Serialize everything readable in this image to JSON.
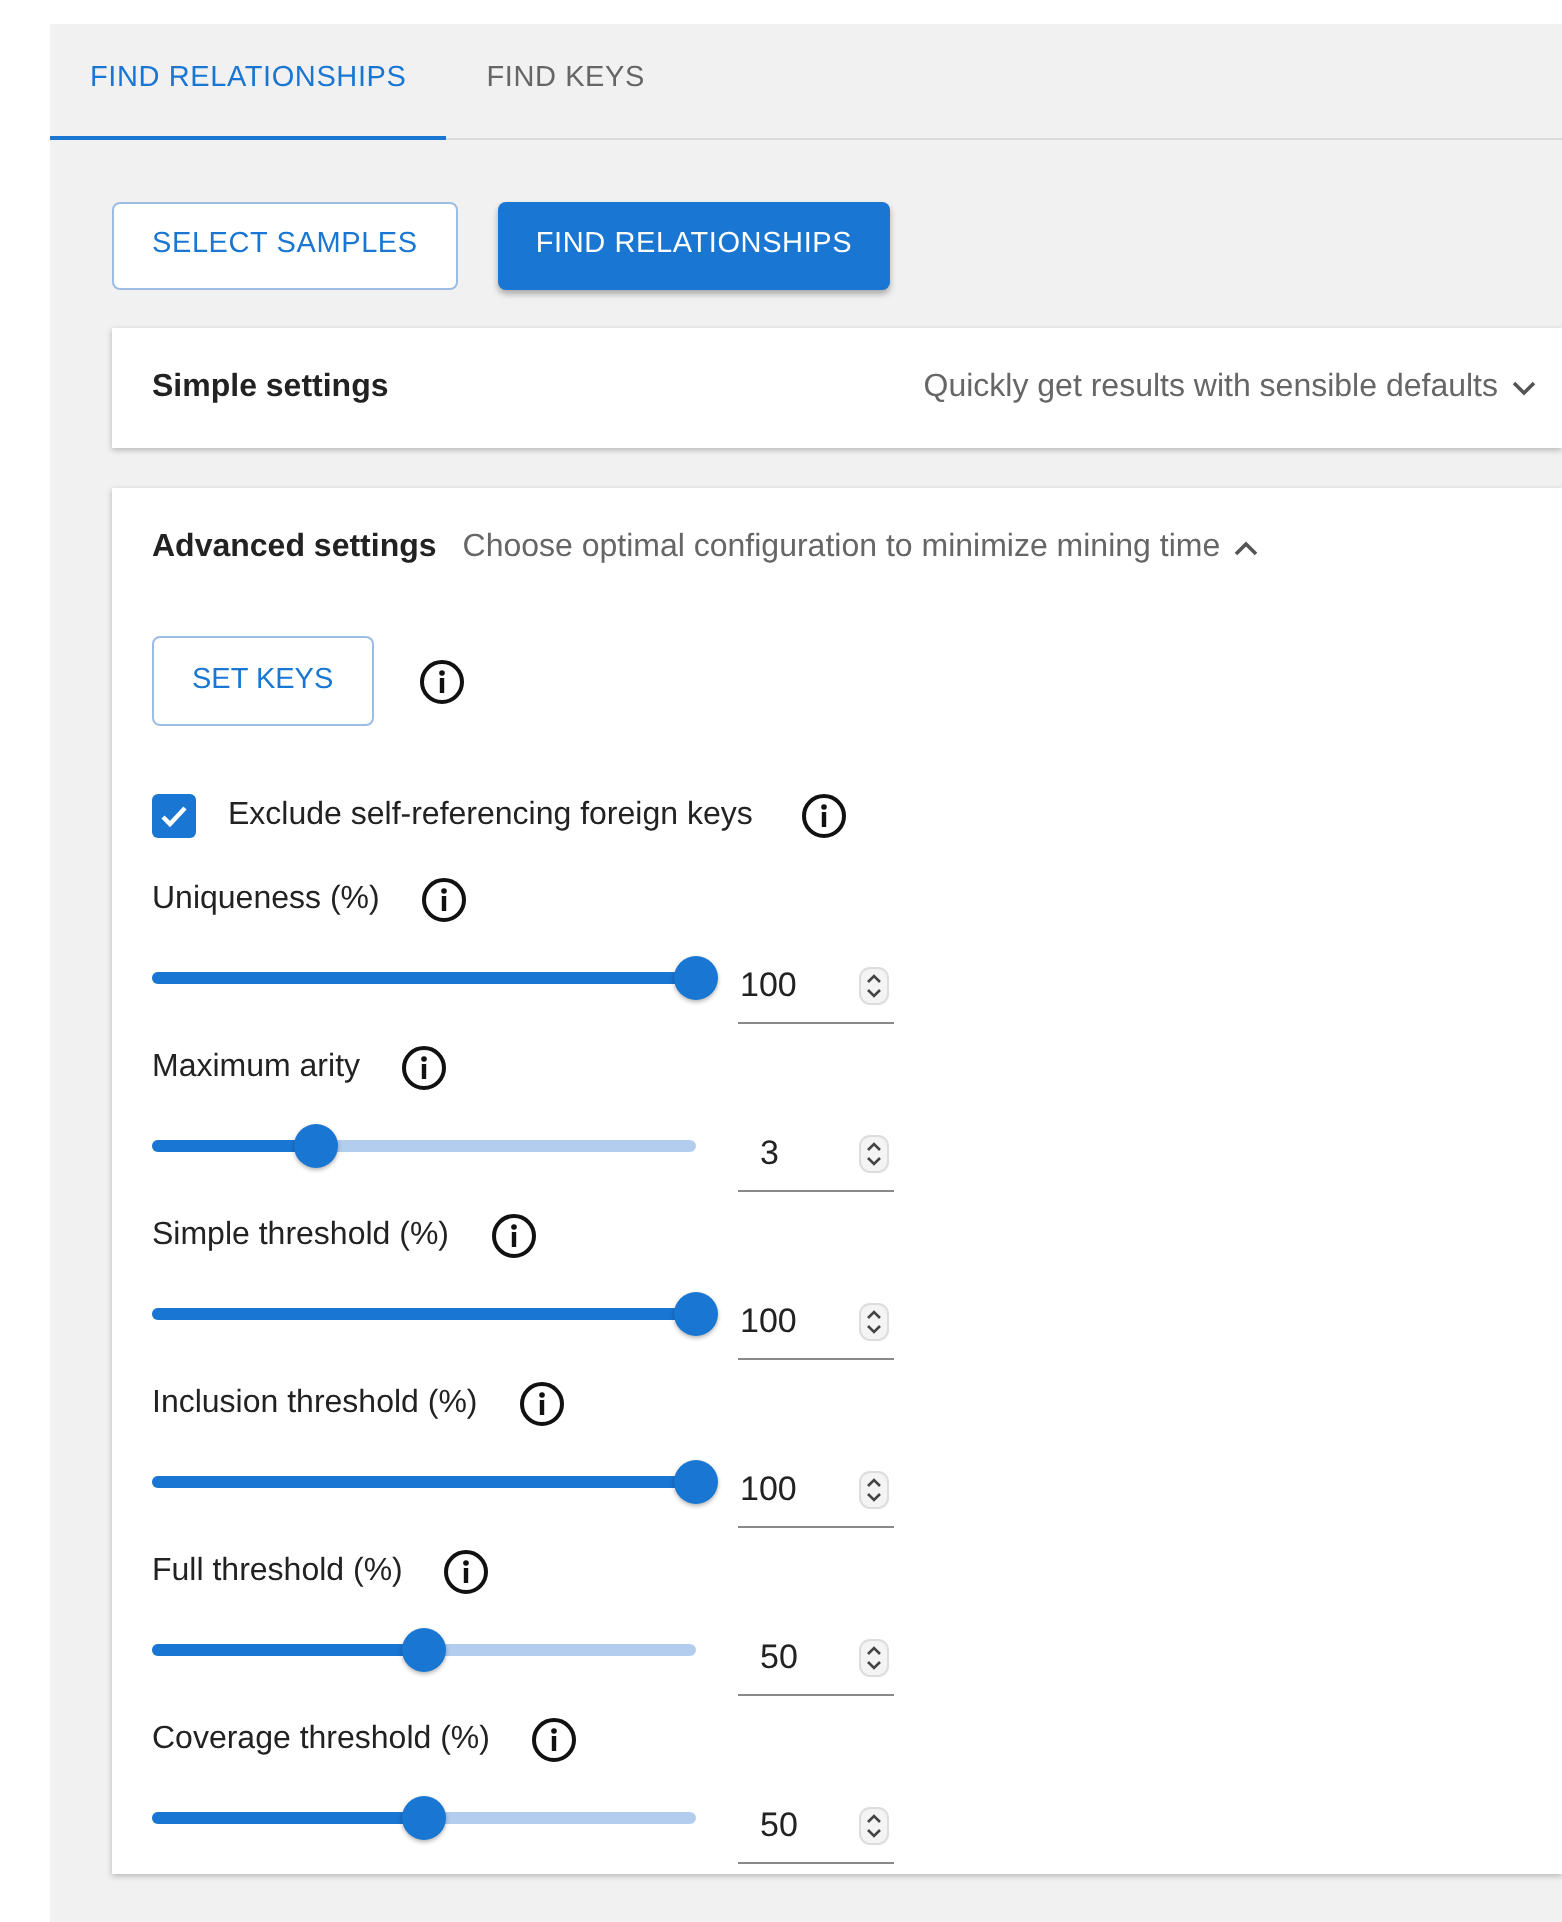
{
  "tabs": [
    {
      "label": "FIND RELATIONSHIPS",
      "selected": true
    },
    {
      "label": "FIND KEYS",
      "selected": false
    }
  ],
  "actions": [
    {
      "label": "SELECT SAMPLES",
      "kind": "outlined"
    },
    {
      "label": "FIND RELATIONSHIPS",
      "kind": "contained"
    }
  ],
  "panels": [
    {
      "title": "Simple settings",
      "subtitle": "Quickly get results with sensible defaults",
      "expanded": false
    },
    {
      "title": "Advanced settings",
      "subtitle": "Choose optimal configuration to minimize mining time",
      "expanded": true,
      "set_keys_button": "SET KEYS",
      "checkbox": {
        "label": "Exclude self-referencing foreign keys",
        "checked": true
      },
      "sliders": [
        {
          "label": "Uniqueness (%)",
          "level": 1,
          "value": "100"
        },
        {
          "label": "Maximum arity",
          "level": 0.3,
          "value": "3"
        },
        {
          "label": "Simple threshold (%)",
          "level": 1,
          "value": "100"
        },
        {
          "label": "Inclusion threshold (%)",
          "level": 1,
          "value": "100"
        },
        {
          "label": "Full threshold (%)",
          "level": 0.5,
          "value": "50"
        },
        {
          "label": "Coverage threshold (%)",
          "level": 0.5,
          "value": "50"
        }
      ]
    }
  ]
}
